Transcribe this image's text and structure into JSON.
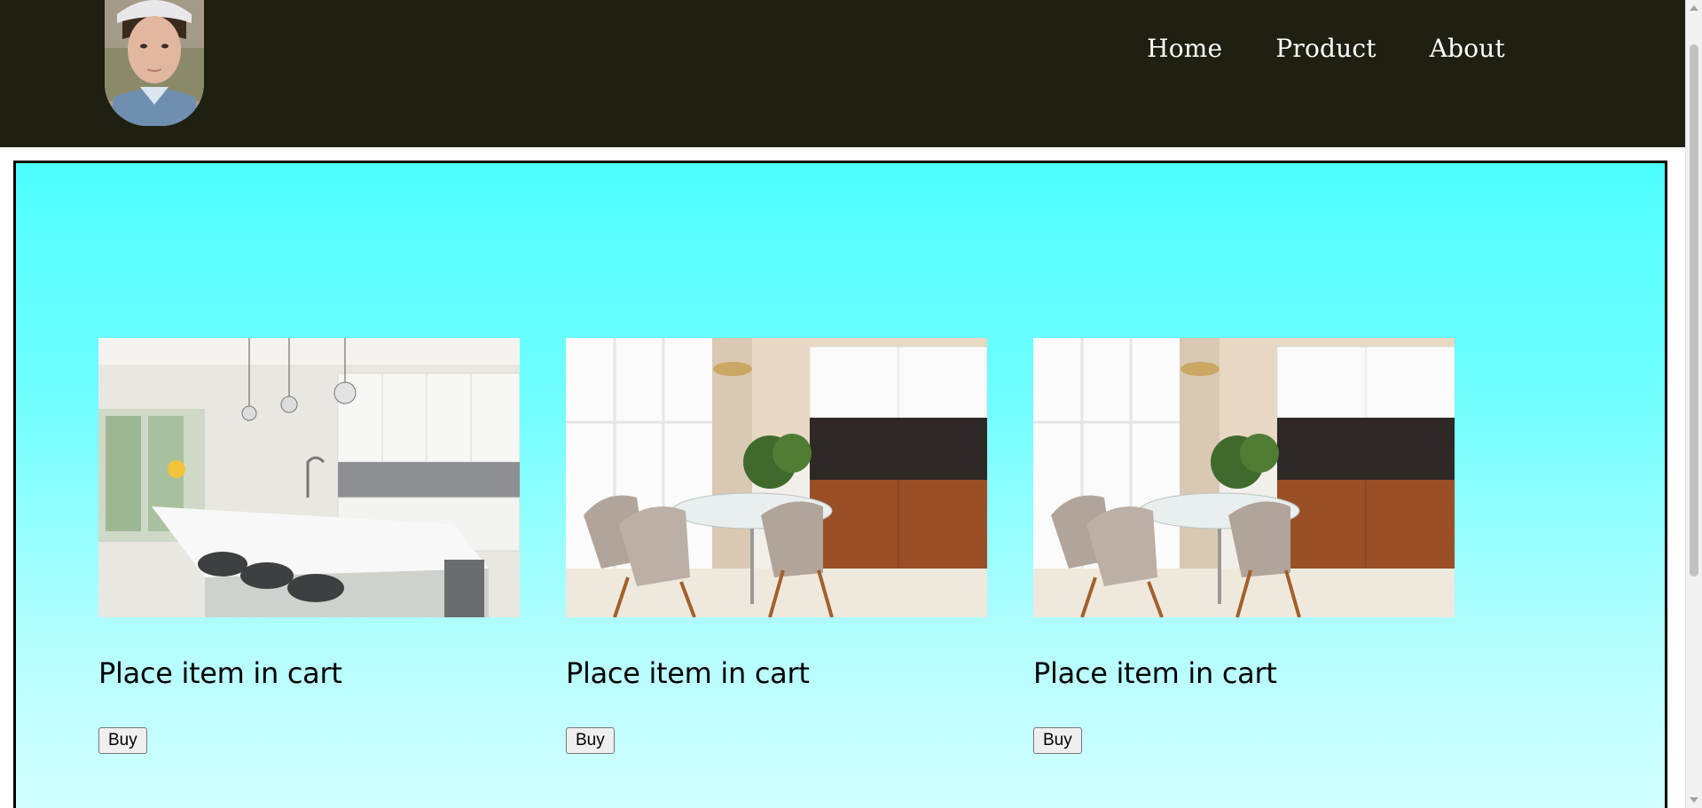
{
  "header": {
    "nav": [
      {
        "label": "Home"
      },
      {
        "label": "Product"
      },
      {
        "label": "About"
      }
    ]
  },
  "products": [
    {
      "title": "Place item in cart",
      "buy_label": "Buy",
      "image": "white-kitchen-island-photo"
    },
    {
      "title": "Place item in cart",
      "buy_label": "Buy",
      "image": "dining-table-chairs-photo"
    },
    {
      "title": "Place item in cart",
      "buy_label": "Buy",
      "image": "dining-table-chairs-photo"
    }
  ],
  "colors": {
    "header_bg": "#1f2011",
    "panel_top": "#4efeff",
    "panel_bottom": "#d2ffff",
    "panel_border": "#000000"
  }
}
